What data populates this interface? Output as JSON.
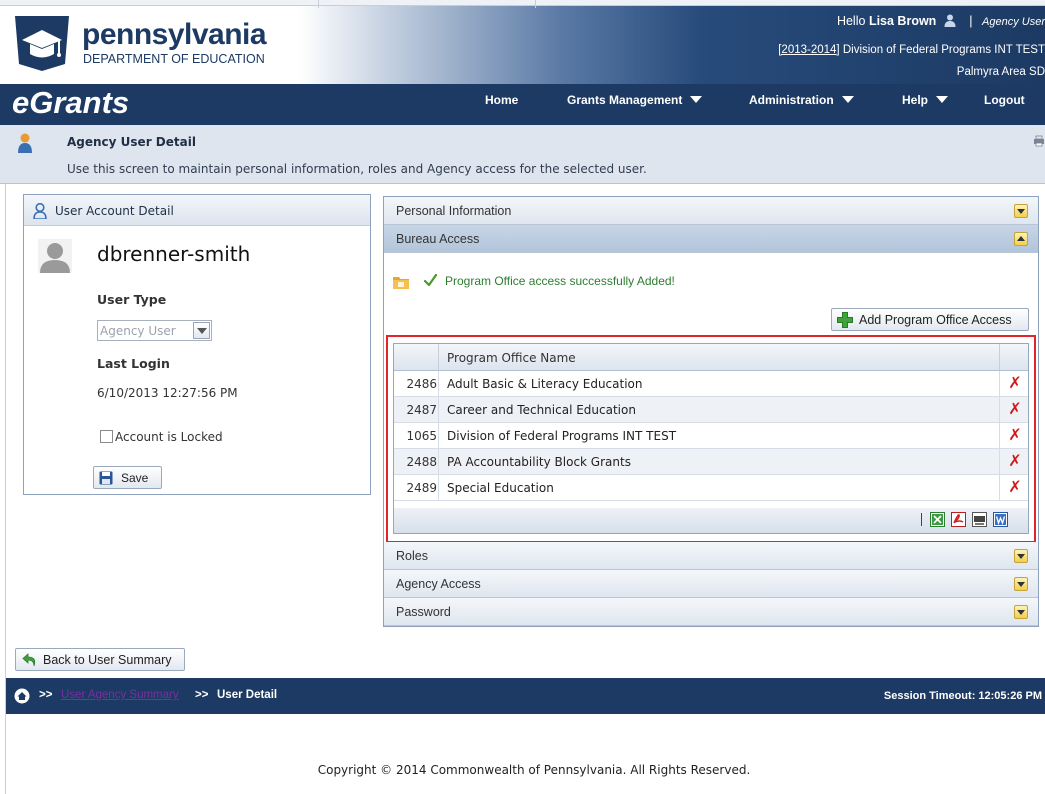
{
  "header": {
    "logo_name": "pennsylvania",
    "logo_dept": "DEPARTMENT OF EDUCATION",
    "hello_prefix": "Hello",
    "user_name": "Lisa Brown",
    "separator": "|",
    "role": "Agency User",
    "year": "[2013-2014]",
    "division": "Division of Federal Programs INT TEST",
    "district": "Palmyra Area SD",
    "app_name": "eGrants"
  },
  "nav": {
    "home": "Home",
    "grants_management": "Grants Management",
    "administration": "Administration",
    "help": "Help",
    "logout": "Logout"
  },
  "page": {
    "title": "Agency User Detail",
    "description": "Use this screen to maintain personal information, roles and Agency access for the selected user."
  },
  "user_account": {
    "header": "User Account Detail",
    "username": "dbrenner-smith",
    "user_type_label": "User Type",
    "user_type_value": "Agency User",
    "last_login_label": "Last Login",
    "last_login_value": "6/10/2013 12:27:56 PM",
    "locked_label": "Account is Locked",
    "locked_checked": false,
    "save_label": "Save"
  },
  "accordion": {
    "personal_information": "Personal Information",
    "bureau_access": "Bureau Access",
    "roles": "Roles",
    "agency_access": "Agency Access",
    "password": "Password"
  },
  "bureau": {
    "success_message": "Program Office access successfully Added!",
    "add_button": "Add Program Office Access",
    "column_name": "Program Office Name",
    "rows": [
      {
        "id": "2486",
        "name": "Adult Basic & Literacy Education"
      },
      {
        "id": "2487",
        "name": "Career and Technical Education"
      },
      {
        "id": "1065",
        "name": "Division of Federal Programs INT TEST"
      },
      {
        "id": "2488",
        "name": "PA Accountability Block Grants"
      },
      {
        "id": "2489",
        "name": "Special Education"
      }
    ],
    "delete_glyph": "✗",
    "export_separator": "|"
  },
  "footer": {
    "back_label": "Back to User Summary",
    "crumb_sep1": ">>",
    "crumb_link": "User Agency Summary",
    "crumb_sep2": ">>",
    "crumb_current": "User Detail",
    "session_timeout": "Session Timeout: 12:05:26 PM",
    "copyright": "Copyright © 2014 Commonwealth of Pennsylvania. All Rights Reserved."
  },
  "colors": {
    "navy": "#1c3a63",
    "success_green": "#2e7d32",
    "delete_red": "#d01a1a",
    "highlight_frame": "#e2252b",
    "accordion_toggle_gold": "#f1cf4b"
  },
  "icons": {
    "user": "user-icon",
    "keystone_logo": "keystone-logo",
    "print": "print-icon",
    "folder": "folder-icon",
    "check": "check-icon",
    "add": "add-icon",
    "delete": "delete-icon",
    "save": "save-icon",
    "back": "back-arrow-icon",
    "home": "home-icon",
    "exports": [
      "excel-export-icon",
      "pdf-export-icon",
      "csv-export-icon",
      "word-export-icon"
    ]
  }
}
